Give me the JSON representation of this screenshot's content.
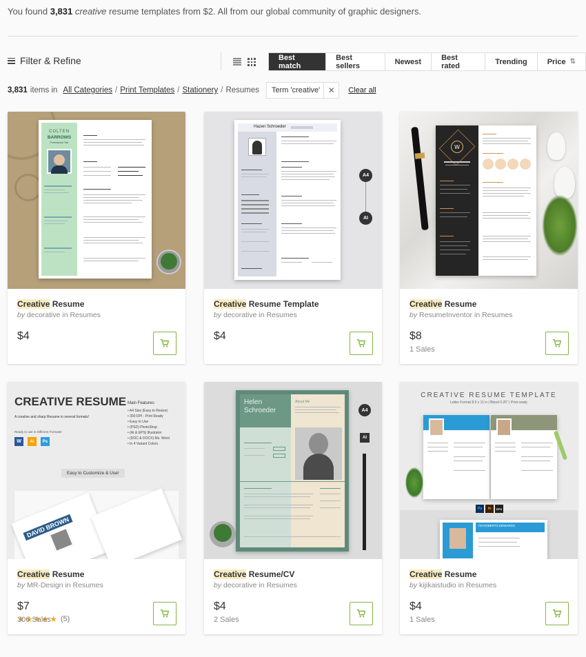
{
  "summary": {
    "prefix": "You found",
    "count": "3,831",
    "term": "creative",
    "suffix": "resume templates from $2. All from our global community of graphic designers."
  },
  "filter": {
    "label": "Filter & Refine",
    "icon": "filter-lines-icon"
  },
  "view_toggle": {
    "list_icon": "list-view-icon",
    "grid_icon": "grid-view-icon"
  },
  "sort_tabs": [
    {
      "label": "Best match",
      "active": true
    },
    {
      "label": "Best sellers"
    },
    {
      "label": "Newest"
    },
    {
      "label": "Best rated"
    },
    {
      "label": "Trending"
    },
    {
      "label": "Price"
    }
  ],
  "breadcrumb": {
    "count": "3,831",
    "items_in": "items in",
    "links": [
      "All Categories",
      "Print Templates",
      "Stationery"
    ],
    "current": "Resumes",
    "term_chip": "Term 'creative'",
    "clear": "Clear all"
  },
  "colors": {
    "accent_green": "#82b541",
    "active_tab": "#333333",
    "highlight": "#f8ecc2"
  },
  "products": [
    {
      "title_hl": "Creative",
      "title_rest": " Resume",
      "by": "by",
      "author": "decorative",
      "in": " in Resumes",
      "price": "$4",
      "sales": "",
      "art": {
        "name_line1": "COLTEN",
        "name_line2": "BARROWS",
        "role": "Professional Title"
      }
    },
    {
      "title_hl": "Creative",
      "title_rest": " Resume Template",
      "by": "by",
      "author": "decorative",
      "in": " in Resumes",
      "price": "$4",
      "sales": "",
      "art": {
        "name": "Hazen Schroeder",
        "badge1": "A4",
        "badge2": "AI"
      }
    },
    {
      "title_hl": "Creative",
      "title_rest": " Resume",
      "by": "by",
      "author": "ResumeInventor",
      "in": " in Resumes",
      "price": "$8",
      "sales": "1 Sales",
      "art": {
        "logo": "W"
      }
    },
    {
      "title_hl": "Creative",
      "title_rest": " Resume",
      "by": "by",
      "author": "MR-Design",
      "in": " in Resumes",
      "price": "$7",
      "rating": 5,
      "rating_count": "(5)",
      "sales": "306 Sales",
      "art": {
        "heading": "CREATIVE RESUME",
        "sub": "A creative and sharp Resume in several formats!",
        "ready": "Ready to use in Different Formats!",
        "features_title": "Main Features:",
        "features": [
          "A4 Size (Easy to Resize)",
          "300 DPI - Print Ready",
          "Easy to Use",
          "(PSD) PhotoShop",
          "(AI & EPS) Illustrator",
          "(DOC & DOCX) Ms. Word",
          "In 4 Variant Colors"
        ],
        "cta": "Easy to Customize & Use!",
        "fmt": [
          "W",
          "Ai",
          "Ps"
        ],
        "name_line1": "DAVID BROWN"
      }
    },
    {
      "title_hl": "Creative",
      "title_rest": " Resume/CV",
      "by": "by",
      "author": "decorative",
      "in": " in Resumes",
      "price": "$4",
      "sales": "2 Sales",
      "art": {
        "name_line1": "Helen",
        "name_line2": "Schroeder",
        "badge1": "A4",
        "badge2": "AI",
        "about": "About Me"
      }
    },
    {
      "title_hl": "Creative",
      "title_rest": " Resume",
      "by": "by",
      "author": "kijikaistudio",
      "in": " in Resumes",
      "price": "$4",
      "sales": "1 Sales",
      "art": {
        "heading": "CREATIVE RESUME TEMPLATE",
        "sub": "Letter Format  8.5 x 11 in  |  Bleed 0.25\"  |  Print ready",
        "name": "I'M ROBERTS EDWARDS",
        "fmt": [
          "Ps",
          "Ai",
          "EPS"
        ]
      }
    }
  ]
}
